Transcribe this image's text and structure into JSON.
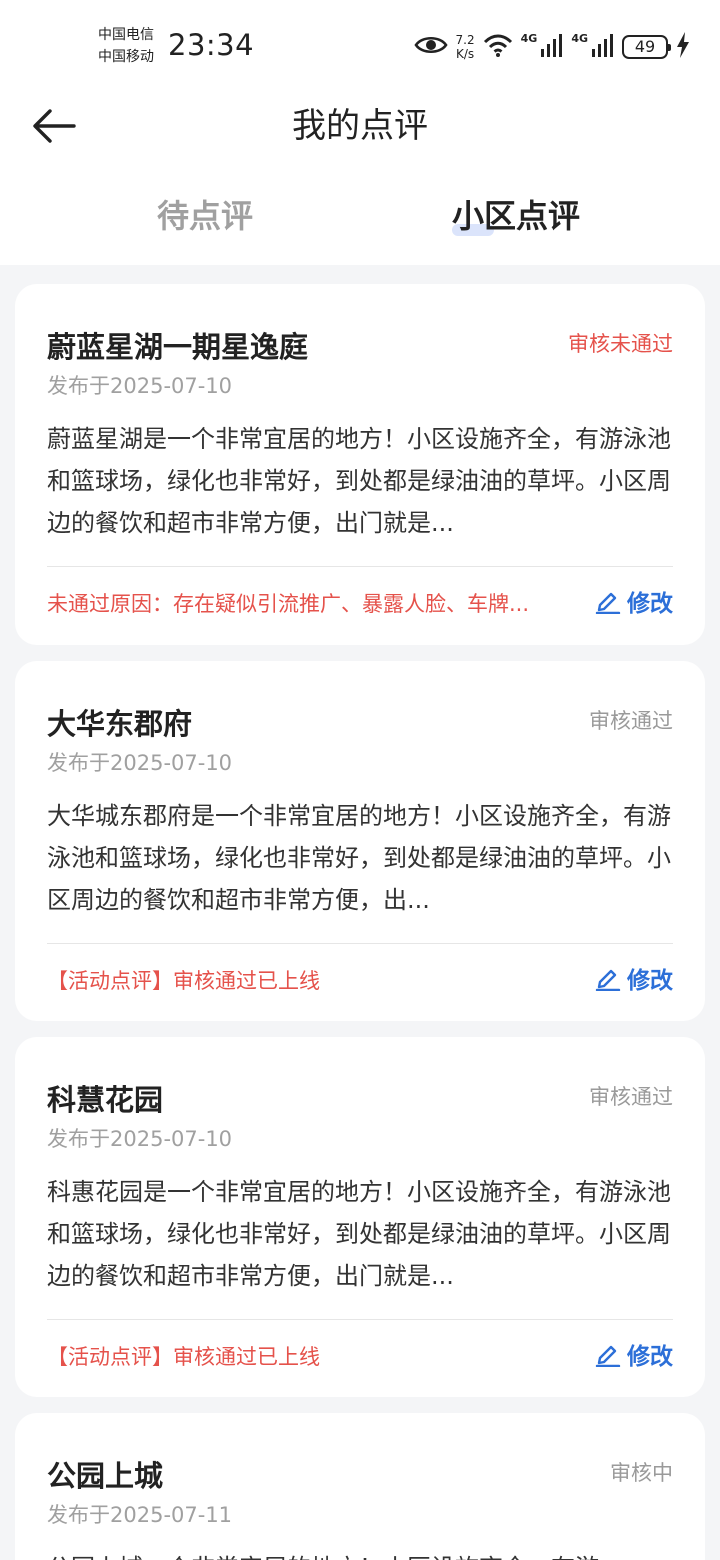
{
  "status_bar": {
    "carrier1": "中国电信",
    "carrier2": "中国移动",
    "time": "23:34",
    "speed_value": "7.2",
    "speed_unit": "K/s",
    "net1": "4G",
    "net2": "4G",
    "battery": "49"
  },
  "header": {
    "title": "我的点评"
  },
  "tabs": [
    {
      "label": "待点评"
    },
    {
      "label": "小区点评"
    }
  ],
  "reviews": [
    {
      "name": "蔚蓝星湖一期星逸庭",
      "status": "审核未通过",
      "date": "发布于2025-07-10",
      "content": "蔚蓝星湖是一个非常宜居的地方！小区设施齐全，有游泳池和篮球场，绿化也非常好，到处都是绿油油的草坪。小区周边的餐饮和超市非常方便，出门就是...",
      "note": "未通过原因：存在疑似引流推广、暴露人脸、车牌...",
      "edit_label": "修改"
    },
    {
      "name": "大华东郡府",
      "status": "审核通过",
      "date": "发布于2025-07-10",
      "content": "大华城东郡府是一个非常宜居的地方！小区设施齐全，有游泳池和篮球场，绿化也非常好，到处都是绿油油的草坪。小区周边的餐饮和超市非常方便，出...",
      "note": "【活动点评】审核通过已上线",
      "edit_label": "修改"
    },
    {
      "name": "科慧花园",
      "status": "审核通过",
      "date": "发布于2025-07-10",
      "content": "科惠花园是一个非常宜居的地方！小区设施齐全，有游泳池和篮球场，绿化也非常好，到处都是绿油油的草坪。小区周边的餐饮和超市非常方便，出门就是...",
      "note": "【活动点评】审核通过已上线",
      "edit_label": "修改"
    },
    {
      "name": "公园上城",
      "status": "审核中",
      "date": "发布于2025-07-11",
      "content": "公园上城一个非常宜居的地方！小区设施齐全，有游"
    }
  ],
  "colors": {
    "accent_blue": "#2c6fd8",
    "reject_red": "#e5524b",
    "muted_gray": "#9a9a9a",
    "page_bg": "#f4f5f7"
  },
  "icons": {
    "back": "arrow-left-icon",
    "edit": "pencil-icon",
    "eye": "eye-icon",
    "wifi": "wifi-icon",
    "signal": "signal-icon",
    "charging": "lightning-icon"
  }
}
